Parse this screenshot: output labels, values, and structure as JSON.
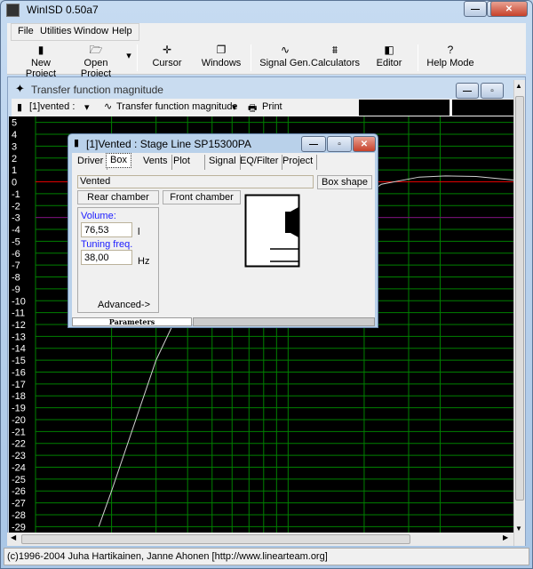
{
  "app": {
    "title": "WinISD 0.50a7",
    "icon": "speaker-app-icon"
  },
  "menu": [
    "File",
    "Utilities",
    "Window",
    "Help"
  ],
  "toolbar": [
    {
      "label": "New Project",
      "icon": "new-project-icon"
    },
    {
      "label": "Open Project",
      "icon": "folder-open-icon"
    },
    {
      "label": "Cursor",
      "icon": "cursor-crosshair-icon"
    },
    {
      "label": "Windows",
      "icon": "windows-icon"
    },
    {
      "label": "Signal Gen.",
      "icon": "sine-wave-icon"
    },
    {
      "label": "Calculators",
      "icon": "calculator-icon"
    },
    {
      "label": "Editor",
      "icon": "speaker-editor-icon"
    },
    {
      "label": "Help Mode",
      "icon": "help-question-icon"
    }
  ],
  "child": {
    "title": "Transfer function magnitude",
    "project_select": "[1]vented :",
    "plot_select": "Transfer function magnitude",
    "print": "Print"
  },
  "chart_data": {
    "type": "line",
    "x_scale": "log",
    "xlim": [
      10,
      780
    ],
    "ylim": [
      -29.5,
      5.5
    ],
    "ytick_labels": [
      "5",
      "4",
      "3",
      "2",
      "1",
      "0",
      "-1",
      "-2",
      "-3",
      "-4",
      "-5",
      "-6",
      "-7",
      "-8",
      "-9",
      "-10",
      "-11",
      "-12",
      "-13",
      "-14",
      "-15",
      "-16",
      "-17",
      "-18",
      "-19",
      "-20",
      "-21",
      "-22",
      "-23",
      "-24",
      "-25",
      "-26",
      "-27",
      "-28",
      "-29"
    ],
    "x_gridlines": [
      10,
      20,
      30,
      40,
      50,
      60,
      70,
      80,
      90,
      100,
      200,
      300,
      400
    ],
    "reference_lines": [
      {
        "y": 0,
        "color": "#e00000"
      },
      {
        "y": -3,
        "color": "#800080"
      }
    ],
    "grid": true,
    "colors": {
      "background": "#000000",
      "grid": "#008000",
      "curve": "#d0d0d0"
    },
    "series": [
      {
        "x": [
          17.8,
          20,
          30,
          35,
          234,
          330,
          420,
          555,
          780
        ],
        "y": [
          -29,
          -26,
          -15,
          -12,
          -0.2,
          0.4,
          0.5,
          0.45,
          0.15
        ]
      }
    ]
  },
  "dialog": {
    "title": "[1]Vented : Stage Line SP15300PA",
    "tabs": [
      "Driver",
      "Box",
      "Vents",
      "Plot",
      "Signal",
      "EQ/Filter",
      "Project"
    ],
    "active_tab": "Box",
    "box_type": "Vented",
    "box_shape": "Box shape",
    "rear": "Rear chamber",
    "front": "Front chamber",
    "volume_label": "Volume:",
    "volume": "76,53",
    "volume_unit": "l",
    "tuning_label": "Tuning freq.",
    "tuning": "38,00",
    "tuning_unit": "Hz",
    "advanced": "Advanced->",
    "panel_tab": "Parameters"
  },
  "status": "(c)1996-2004 Juha Hartikainen, Janne Ahonen [http://www.linearteam.org]"
}
